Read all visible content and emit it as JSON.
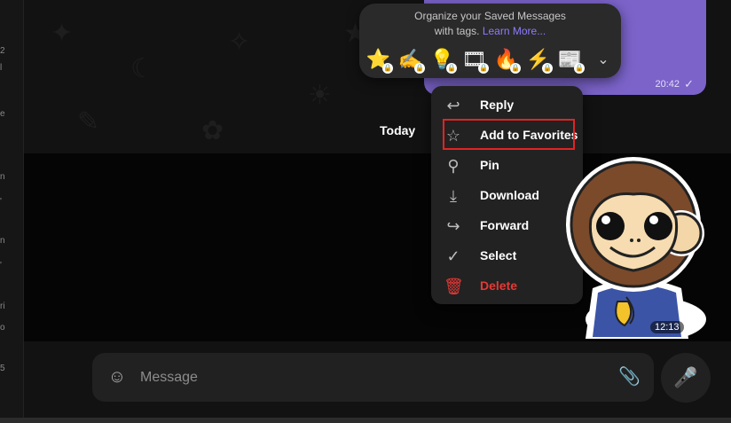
{
  "left_strip_letters": [
    "2",
    "l",
    "e",
    "n",
    "'",
    "n",
    "'",
    "ri",
    "o",
    "5"
  ],
  "tag_panel": {
    "line1": "Organize your Saved Messages",
    "line2_prefix": "with tags.",
    "link": "Learn More...",
    "tags": [
      {
        "icon": "star-tag-icon",
        "glyph": "⭐"
      },
      {
        "icon": "writing-hand-tag-icon",
        "glyph": "✍"
      },
      {
        "icon": "lightbulb-tag-icon",
        "glyph": "💡"
      },
      {
        "icon": "film-tag-icon",
        "glyph": "🎞"
      },
      {
        "icon": "fire-tag-icon",
        "glyph": "🔥"
      },
      {
        "icon": "lightning-tag-icon",
        "glyph": "⚡"
      },
      {
        "icon": "newspaper-tag-icon",
        "glyph": "📰"
      }
    ],
    "expand_glyph": "⌄"
  },
  "purple_message": {
    "time": "20:42",
    "check": "✓"
  },
  "date_divider": "Today",
  "context_menu": {
    "items": [
      {
        "label": "Reply",
        "icon": "reply-icon",
        "glyph": "↩"
      },
      {
        "label": "Add to Favorites",
        "icon": "star-icon",
        "glyph": "☆"
      },
      {
        "label": "Pin",
        "icon": "pin-icon",
        "glyph": "⚲"
      },
      {
        "label": "Download",
        "icon": "download-icon",
        "glyph": "⤓"
      },
      {
        "label": "Forward",
        "icon": "forward-icon",
        "glyph": "↪"
      },
      {
        "label": "Select",
        "icon": "select-check-icon",
        "glyph": "✓"
      },
      {
        "label": "Delete",
        "icon": "trash-icon",
        "glyph": "🗑"
      }
    ]
  },
  "sticker_message": {
    "time": "12:13",
    "check": "✓"
  },
  "composer": {
    "placeholder": "Message",
    "emoji_glyph": "☺",
    "attach_glyph": "📎",
    "mic_glyph": "🎤"
  },
  "colors": {
    "accent": "#8d7bff",
    "bubble": "#7b63c9",
    "danger": "#e53935",
    "highlight": "#e02424"
  }
}
